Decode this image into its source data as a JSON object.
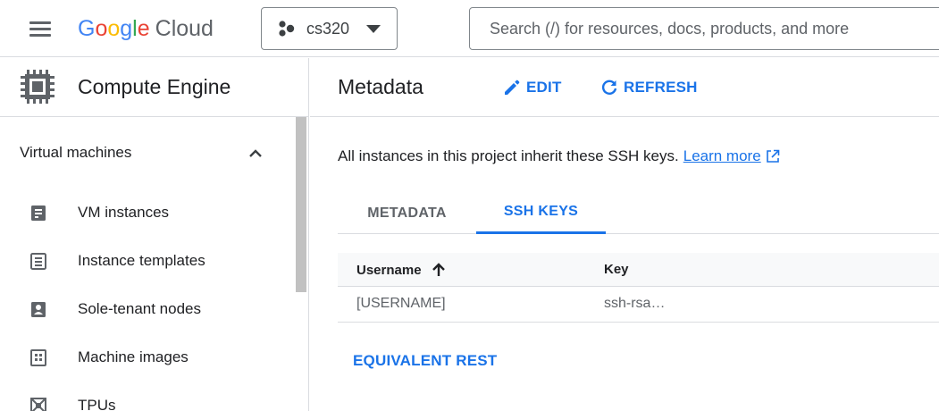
{
  "header": {
    "logo_google": [
      "G",
      "o",
      "o",
      "g",
      "l",
      "e"
    ],
    "logo_google_colors": [
      "#4285f4",
      "#ea4335",
      "#fbbc05",
      "#4285f4",
      "#34a853",
      "#ea4335"
    ],
    "logo_cloud": "Cloud",
    "project_name": "cs320",
    "search_placeholder": "Search (/) for resources, docs, products, and more"
  },
  "sidebar": {
    "product_title": "Compute Engine",
    "group_label": "Virtual machines",
    "items": [
      {
        "label": "VM instances",
        "icon": "vm-instances-icon"
      },
      {
        "label": "Instance templates",
        "icon": "instance-templates-icon"
      },
      {
        "label": "Sole-tenant nodes",
        "icon": "sole-tenant-nodes-icon"
      },
      {
        "label": "Machine images",
        "icon": "machine-images-icon"
      },
      {
        "label": "TPUs",
        "icon": "tpus-icon"
      }
    ]
  },
  "main": {
    "title": "Metadata",
    "edit_label": "EDIT",
    "refresh_label": "REFRESH",
    "info_text": "All instances in this project inherit these SSH keys.",
    "learn_more": "Learn more",
    "tabs": [
      {
        "label": "METADATA",
        "active": false
      },
      {
        "label": "SSH KEYS",
        "active": true
      }
    ],
    "table": {
      "columns": [
        "Username",
        "Key"
      ],
      "sort": "ascending",
      "rows": [
        {
          "username": "[USERNAME]",
          "key": "ssh-rsa…"
        }
      ]
    },
    "equivalent_rest": "EQUIVALENT REST"
  },
  "colors": {
    "accent": "#1a73e8",
    "text": "#202124",
    "muted": "#5f6368",
    "divider": "#dadce0"
  }
}
